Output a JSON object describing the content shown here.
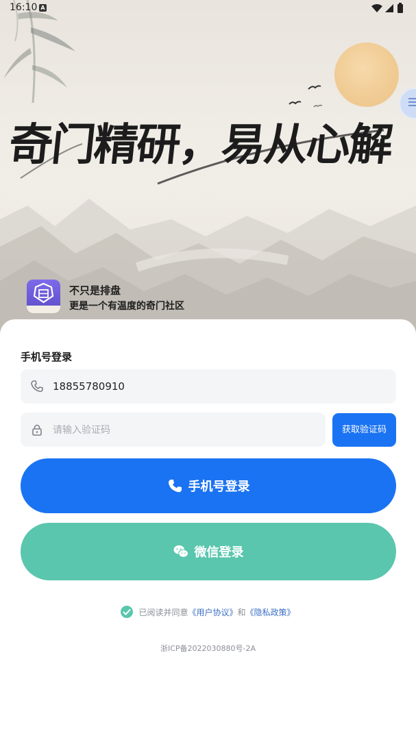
{
  "status_bar": {
    "time": "16:10",
    "notification_badge": "A"
  },
  "hero": {
    "slogan": "奇门精研，易从心解",
    "brand_title": "不只是排盘",
    "brand_subtitle": "更是一个有温度的奇门社区"
  },
  "login": {
    "section_title": "手机号登录",
    "phone_value": "18855780910",
    "code_placeholder": "请输入验证码",
    "get_code_label": "获取验证码",
    "phone_login_label": "手机号登录",
    "wechat_login_label": "微信登录",
    "agreement_prefix": "已阅读并同意",
    "user_agreement": "《用户协议》",
    "and_text": "和",
    "privacy_policy": "《隐私政策》",
    "icp": "浙ICP备2022030880号-2A"
  },
  "colors": {
    "primary": "#1a73f2",
    "wechat": "#5ac6ae",
    "link": "#3c6fc4"
  },
  "icons": [
    "phone-icon",
    "lock-icon",
    "wechat-icon",
    "check-icon",
    "menu-icon",
    "wifi-icon",
    "signal-icon",
    "battery-icon"
  ]
}
